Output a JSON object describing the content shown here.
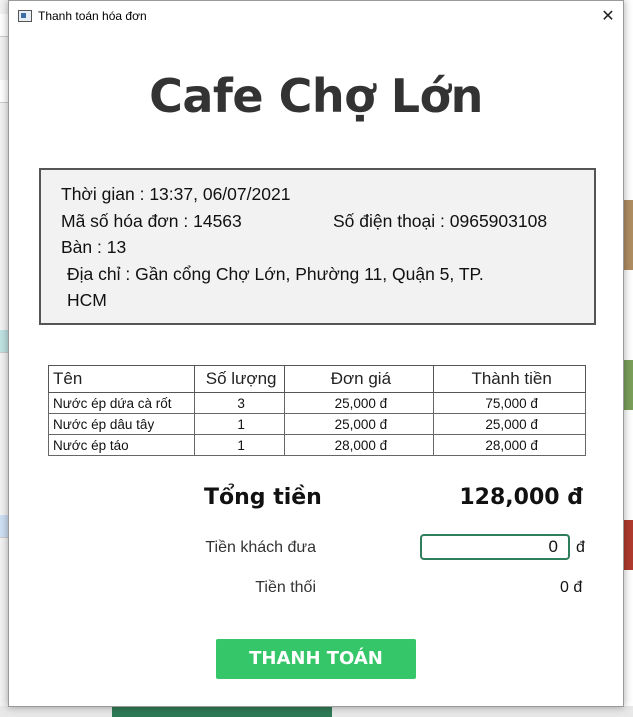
{
  "window": {
    "title": "Thanh toán hóa đơn",
    "close_symbol": "✕"
  },
  "shop": {
    "name": "Cafe Chợ Lớn"
  },
  "invoice": {
    "time_line": "Thời gian : 13:37, 06/07/2021",
    "id_line": "Mã số hóa đơn : 14563",
    "phone_line": "Số điện thoại : 0965903108",
    "table_line": "Bàn : 13",
    "address_line1": "Địa chỉ : Gần cổng Chợ Lớn, Phường 11, Quận 5, TP.",
    "address_line2": "HCM"
  },
  "items_table": {
    "headers": [
      "Tên",
      "Số lượng",
      "Đơn giá",
      "Thành tiền"
    ],
    "rows": [
      [
        "Nước ép dứa cà rốt",
        "3",
        "25,000 đ",
        "75,000 đ"
      ],
      [
        "Nước ép dâu tây",
        "1",
        "25,000 đ",
        "25,000 đ"
      ],
      [
        "Nước ép táo",
        "1",
        "28,000 đ",
        "28,000 đ"
      ]
    ]
  },
  "summary": {
    "total_label": "Tổng tiền",
    "total_value": "128,000 đ",
    "paid_label": "Tiền khách đưa",
    "paid_value": "0",
    "paid_currency": "đ",
    "change_label": "Tiền thối",
    "change_value": "0 đ"
  },
  "actions": {
    "pay_label": "THANH TOÁN"
  },
  "colors": {
    "accent_button": "#36c66a",
    "input_border": "#2e7d5b",
    "shop_name": "#333333",
    "info_box_bg": "#f2f2f2"
  }
}
